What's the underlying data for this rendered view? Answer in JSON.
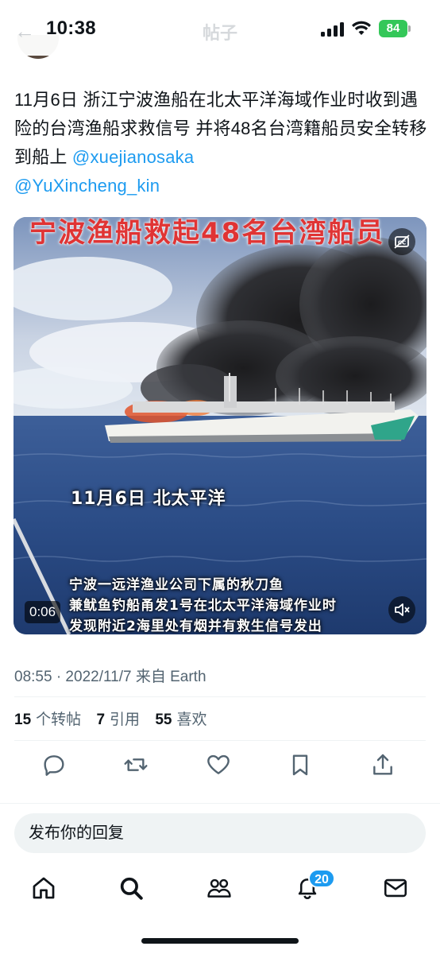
{
  "status_bar": {
    "time": "10:38",
    "battery": "84",
    "ghost_title": "帖子"
  },
  "tweet": {
    "text_prefix": "11月6日 浙江宁波渔船在北太平洋海域作业时收到遇险的台湾渔船求救信号 并将48名台湾籍船员安全转移到船上 ",
    "mention_1": "@xuejianosaka",
    "mention_2": "@YuXincheng_kin"
  },
  "media": {
    "banner_text": "宁波渔船救起48名台湾船员",
    "date_caption": "11月6日  北太平洋",
    "subtitle_lines": [
      "宁波一远洋渔业公司下属的秋刀鱼",
      "兼鱿鱼钓船甬发1号在北太平洋海域作业时",
      "发现附近2海里处有烟并有救生信号发出"
    ],
    "duration": "0:06"
  },
  "meta": {
    "timestamp": "08:55 · 2022/11/7 来自 Earth",
    "retweets_count": "15",
    "retweets_label": "个转帖",
    "quotes_count": "7",
    "quotes_label": "引用",
    "likes_count": "55",
    "likes_label": "喜欢"
  },
  "reply": {
    "placeholder": "发布你的回复"
  },
  "tab_bar": {
    "notifications_badge": "20"
  },
  "colors": {
    "accent": "#1d9bf0",
    "text_primary": "#0f1419",
    "text_secondary": "#536471",
    "battery": "#34c759"
  },
  "icons": [
    "back-arrow-icon",
    "signal-icon",
    "wifi-icon",
    "battery-icon",
    "captions-icon",
    "mute-icon",
    "reply-icon",
    "retweet-icon",
    "like-icon",
    "bookmark-icon",
    "share-icon",
    "home-icon",
    "search-icon",
    "communities-icon",
    "notifications-icon",
    "messages-icon"
  ]
}
